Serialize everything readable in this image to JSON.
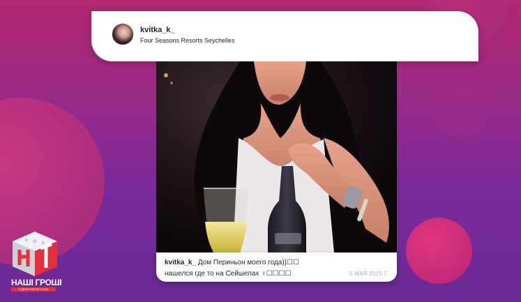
{
  "post": {
    "username": "kvitka_k_",
    "location": "Four Seasons Resorts Seychelles",
    "caption_user": "kvitka_k_",
    "caption_text_line1": "Дом Периньон моего года))☐☐",
    "caption_text_line2": "нашелся где то на Сейшелах ♀☐☐☐☐",
    "date": "5 МАЯ 2015 Г."
  },
  "logo": {
    "name": "НАШІ ГРОШІ",
    "tagline": "З ДЕНИСОМ БІГУСОМ"
  },
  "colors": {
    "background_top": "#b3276e",
    "background_bottom": "#6a2a94",
    "card": "#ffffff",
    "logo_red": "#e8303c"
  }
}
